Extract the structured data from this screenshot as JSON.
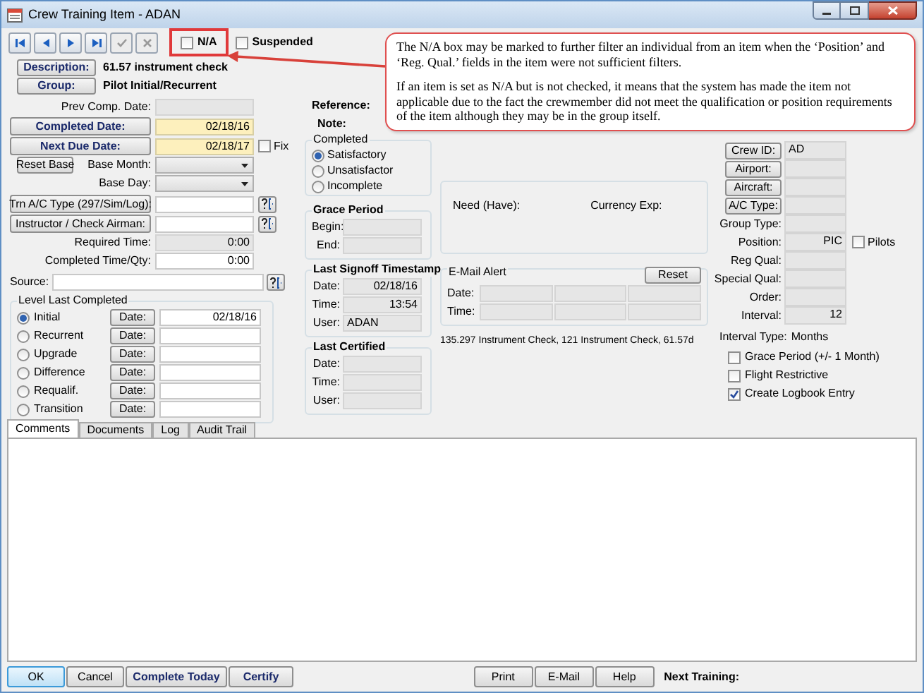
{
  "window": {
    "title": "Crew Training Item - ADAN"
  },
  "toolbar": {
    "nav_buttons": [
      {
        "kind": "first",
        "disabled": false
      },
      {
        "kind": "previous",
        "disabled": false
      },
      {
        "kind": "next",
        "disabled": false
      },
      {
        "kind": "last",
        "disabled": false
      },
      {
        "kind": "accept",
        "disabled": true
      },
      {
        "kind": "cancel",
        "disabled": true
      }
    ],
    "na": {
      "label": "N/A",
      "checked": false
    },
    "suspended": {
      "label": "Suspended",
      "checked": false
    }
  },
  "header": {
    "description": {
      "button": "Description:",
      "value": "61.57 instrument check"
    },
    "group": {
      "button": "Group:",
      "value": "Pilot Initial/Recurrent"
    }
  },
  "dates": [
    {
      "kind": "label",
      "label": "Prev Comp. Date:",
      "highlight": false
    },
    {
      "kind": "button",
      "label": "Completed Date:",
      "value": "02/18/16",
      "highlight": true
    },
    {
      "kind": "button",
      "label": "Next Due Date:",
      "value": "02/18/17",
      "highlight": true,
      "fix": {
        "label": "Fix",
        "checked": false
      }
    }
  ],
  "base": {
    "reset_button": "Reset Base",
    "selects": [
      {
        "label": "Base Month:"
      },
      {
        "label": "Base Day:"
      }
    ]
  },
  "lookups": [
    {
      "button": "Trn A/C Type (297/Sim/Log):"
    },
    {
      "button": "Instructor / Check Airman:"
    }
  ],
  "times": [
    {
      "label": "Required Time:",
      "value": "0:00",
      "readonly": true
    },
    {
      "label": "Completed Time/Qty:",
      "value": "0:00",
      "readonly": false
    }
  ],
  "source": {
    "label": "Source:"
  },
  "level_last_completed": {
    "title": "Level Last Completed",
    "levels": [
      {
        "label": "Initial",
        "selected": true,
        "date_button": "Date:",
        "date": "02/18/16"
      },
      {
        "label": "Recurrent",
        "selected": false,
        "date_button": "Date:"
      },
      {
        "label": "Upgrade",
        "selected": false,
        "date_button": "Date:"
      },
      {
        "label": "Difference",
        "selected": false,
        "date_button": "Date:"
      },
      {
        "label": "Requalif.",
        "selected": false,
        "date_button": "Date:"
      },
      {
        "label": "Transition",
        "selected": false,
        "date_button": "Date:"
      }
    ]
  },
  "reference": {
    "reference_label": "Reference:",
    "note_label": "Note:"
  },
  "completed": {
    "title": "Completed",
    "options": [
      {
        "label": "Satisfactory",
        "selected": true
      },
      {
        "label": "Unsatisfactor",
        "selected": false
      },
      {
        "label": "Incomplete",
        "selected": false
      }
    ]
  },
  "grace_period": {
    "title": "Grace Period",
    "fields": [
      {
        "label": "Begin:"
      },
      {
        "label": "End:"
      }
    ]
  },
  "last_signoff": {
    "title": "Last Signoff Timestamp",
    "fields": [
      {
        "kind": "date",
        "label": "Date:",
        "value": "02/18/16"
      },
      {
        "kind": "time",
        "label": "Time:",
        "value": "13:54"
      },
      {
        "kind": "user",
        "label": "User:",
        "value": "ADAN"
      }
    ]
  },
  "last_certified": {
    "title": "Last Certified",
    "fields": [
      {
        "label": "Date:"
      },
      {
        "label": "Time:"
      },
      {
        "label": "User:"
      }
    ]
  },
  "currency": {
    "need_label": "Need (Have):",
    "currency_label": "Currency Exp:"
  },
  "email_alert": {
    "title": "E-Mail Alert",
    "reset_button": "Reset",
    "rows": [
      {
        "label": "Date:"
      },
      {
        "label": "Time:"
      }
    ]
  },
  "related_items": "135.297 Instrument Check, 121 Instrument Check, 61.57d",
  "item_fields": [
    {
      "kind": "button",
      "label": "Crew ID:",
      "value": "AD"
    },
    {
      "kind": "button",
      "label": "Airport:"
    },
    {
      "kind": "button",
      "label": "Aircraft:"
    },
    {
      "kind": "button",
      "label": "A/C Type:"
    },
    {
      "kind": "label",
      "label": "Group Type:"
    },
    {
      "kind": "label",
      "label": "Position:",
      "value": "PIC",
      "pilots": {
        "label": "Pilots",
        "checked": false
      }
    },
    {
      "kind": "label",
      "label": "Reg Qual:"
    },
    {
      "kind": "label",
      "label": "Special Qual:"
    },
    {
      "kind": "label",
      "label": "Order:"
    },
    {
      "kind": "label",
      "label": "Interval:",
      "value": "12"
    }
  ],
  "interval_type": {
    "label": "Interval Type:",
    "value": "Months"
  },
  "options": [
    {
      "label": "Grace Period (+/- 1 Month)",
      "checked": false
    },
    {
      "label": "Flight Restrictive",
      "checked": false
    },
    {
      "label": "Create Logbook Entry",
      "checked": true
    }
  ],
  "tabs": [
    {
      "label": "Comments",
      "selected": true
    },
    {
      "label": "Documents",
      "selected": false
    },
    {
      "label": "Log",
      "selected": false
    },
    {
      "label": "Audit Trail",
      "selected": false
    }
  ],
  "footer": {
    "left_buttons": [
      {
        "label": "OK",
        "bold": false,
        "focused": true
      },
      {
        "label": "Cancel",
        "bold": false,
        "focused": false
      },
      {
        "label": "Complete Today",
        "bold": true,
        "focused": false
      },
      {
        "label": "Certify",
        "bold": true,
        "focused": false
      }
    ],
    "right_buttons": [
      {
        "label": "Print"
      },
      {
        "label": "E-Mail"
      },
      {
        "label": "Help"
      }
    ],
    "next_training_label": "Next Training:"
  },
  "callout": {
    "paragraphs": [
      "The N/A box may be marked to further filter an individual from an item when the ‘Position’ and ‘Reg. Qual.’ fields in the item were not sufficient filters.",
      "If an item is set as N/A but is not checked, it means that the system has made the item not applicable due to the fact the crewmember did not meet the qualification or position requirements of the item although they may be in the group itself."
    ]
  }
}
